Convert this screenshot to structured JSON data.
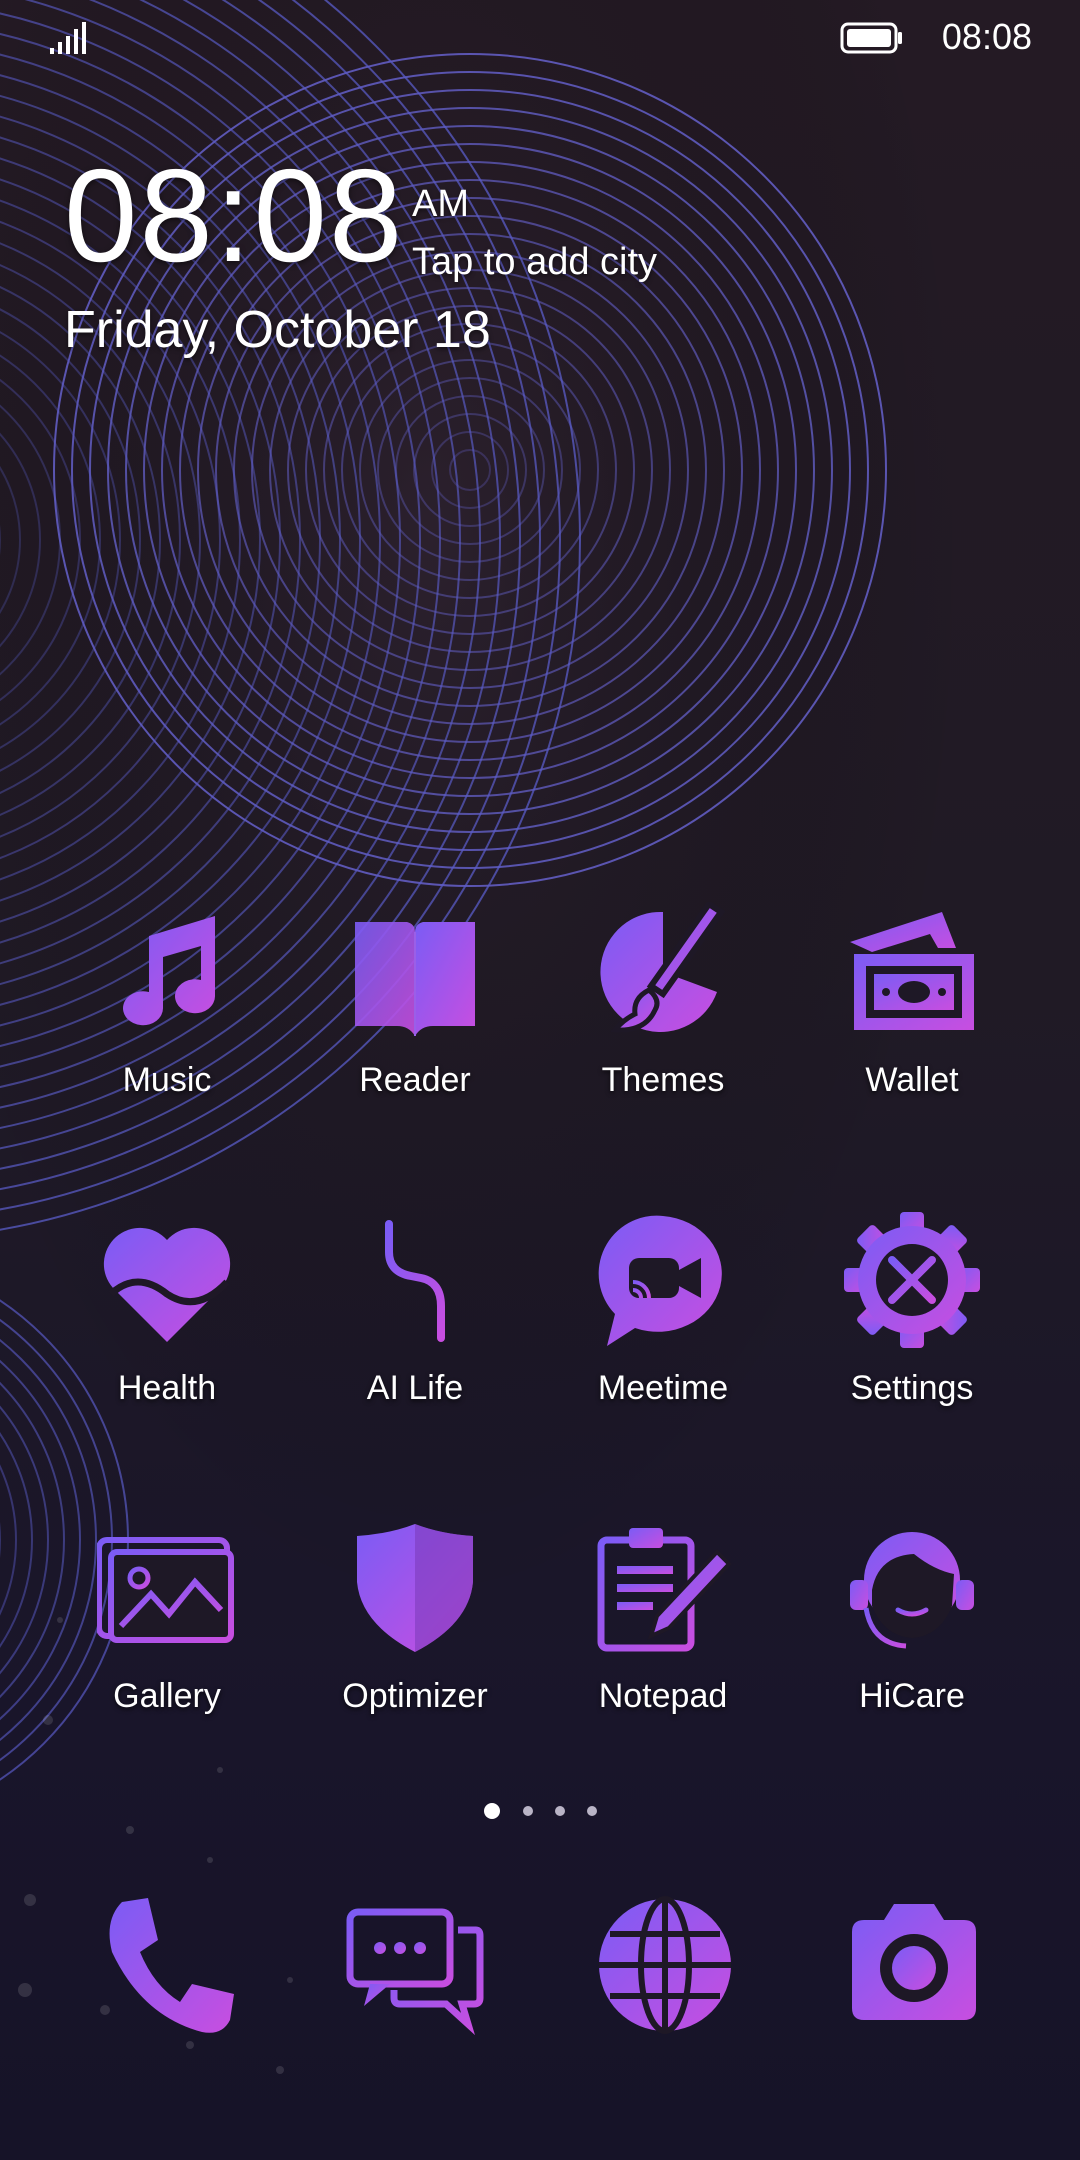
{
  "status_bar": {
    "time": "08:08"
  },
  "clock": {
    "time": "08:08",
    "ampm": "AM",
    "city_prompt": "Tap to add city",
    "date": "Friday, October 18"
  },
  "apps": [
    {
      "label": "Music",
      "icon": "music-note-icon"
    },
    {
      "label": "Reader",
      "icon": "book-icon"
    },
    {
      "label": "Themes",
      "icon": "paintbrush-icon"
    },
    {
      "label": "Wallet",
      "icon": "wallet-icon"
    },
    {
      "label": "Health",
      "icon": "heart-icon"
    },
    {
      "label": "AI Life",
      "icon": "ai-life-icon"
    },
    {
      "label": "Meetime",
      "icon": "video-chat-icon"
    },
    {
      "label": "Settings",
      "icon": "gear-icon"
    },
    {
      "label": "Gallery",
      "icon": "photo-icon"
    },
    {
      "label": "Optimizer",
      "icon": "shield-icon"
    },
    {
      "label": "Notepad",
      "icon": "notepad-icon"
    },
    {
      "label": "HiCare",
      "icon": "headset-icon"
    }
  ],
  "page_indicator": {
    "pages": 4,
    "current": 1
  },
  "dock": [
    {
      "icon": "phone-icon"
    },
    {
      "icon": "messages-icon"
    },
    {
      "icon": "browser-globe-icon"
    },
    {
      "icon": "camera-icon"
    }
  ],
  "colors": {
    "icon_gradient_start": "#7b5cf5",
    "icon_gradient_end": "#c84ee0",
    "ring_color": "#6a66d8"
  }
}
